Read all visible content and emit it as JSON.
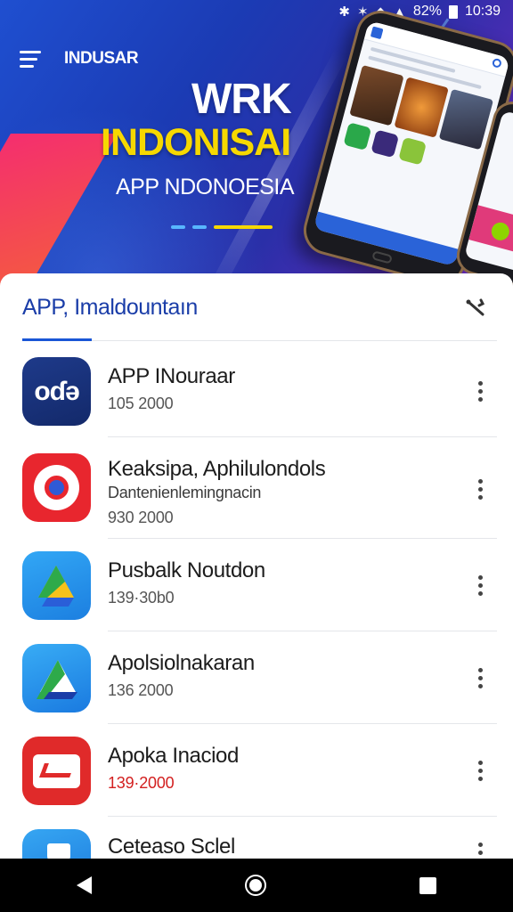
{
  "status_bar": {
    "battery": "82%",
    "time": "10:39"
  },
  "app_bar": {
    "brand": "INDUSAR"
  },
  "hero": {
    "title_line1": "WRK",
    "title_line2": "INDONISAI",
    "subtitle": "APP NDONOESIA"
  },
  "section": {
    "title": "APP, Imaldountaın"
  },
  "apps": [
    {
      "name": "APP INouraar",
      "meta": "105 2000",
      "icon": "blue-square-logo"
    },
    {
      "name": "Keaksipa, Aphilulondols",
      "desc": "Dantenienlemingnacin",
      "meta": "930 2000",
      "icon": "red-circle-refresh-icon"
    },
    {
      "name": "Pusbalk Noutdon",
      "meta": "139·30b0",
      "icon": "drive-triangle-icon"
    },
    {
      "name": "Apolsiolnakaran",
      "meta": "136 2000",
      "icon": "drive-triangle-icon"
    },
    {
      "name": "Apoka Inaciod",
      "meta": "139·2000",
      "icon": "red-arrow-card-icon"
    },
    {
      "name": "Ceteaso Sclel",
      "icon": "blue-cup-icon"
    }
  ],
  "colors": {
    "accent": "#1a56d6",
    "section_title": "#1a3da8",
    "hero_yellow": "#f6d800",
    "meta_red": "#d32020"
  }
}
